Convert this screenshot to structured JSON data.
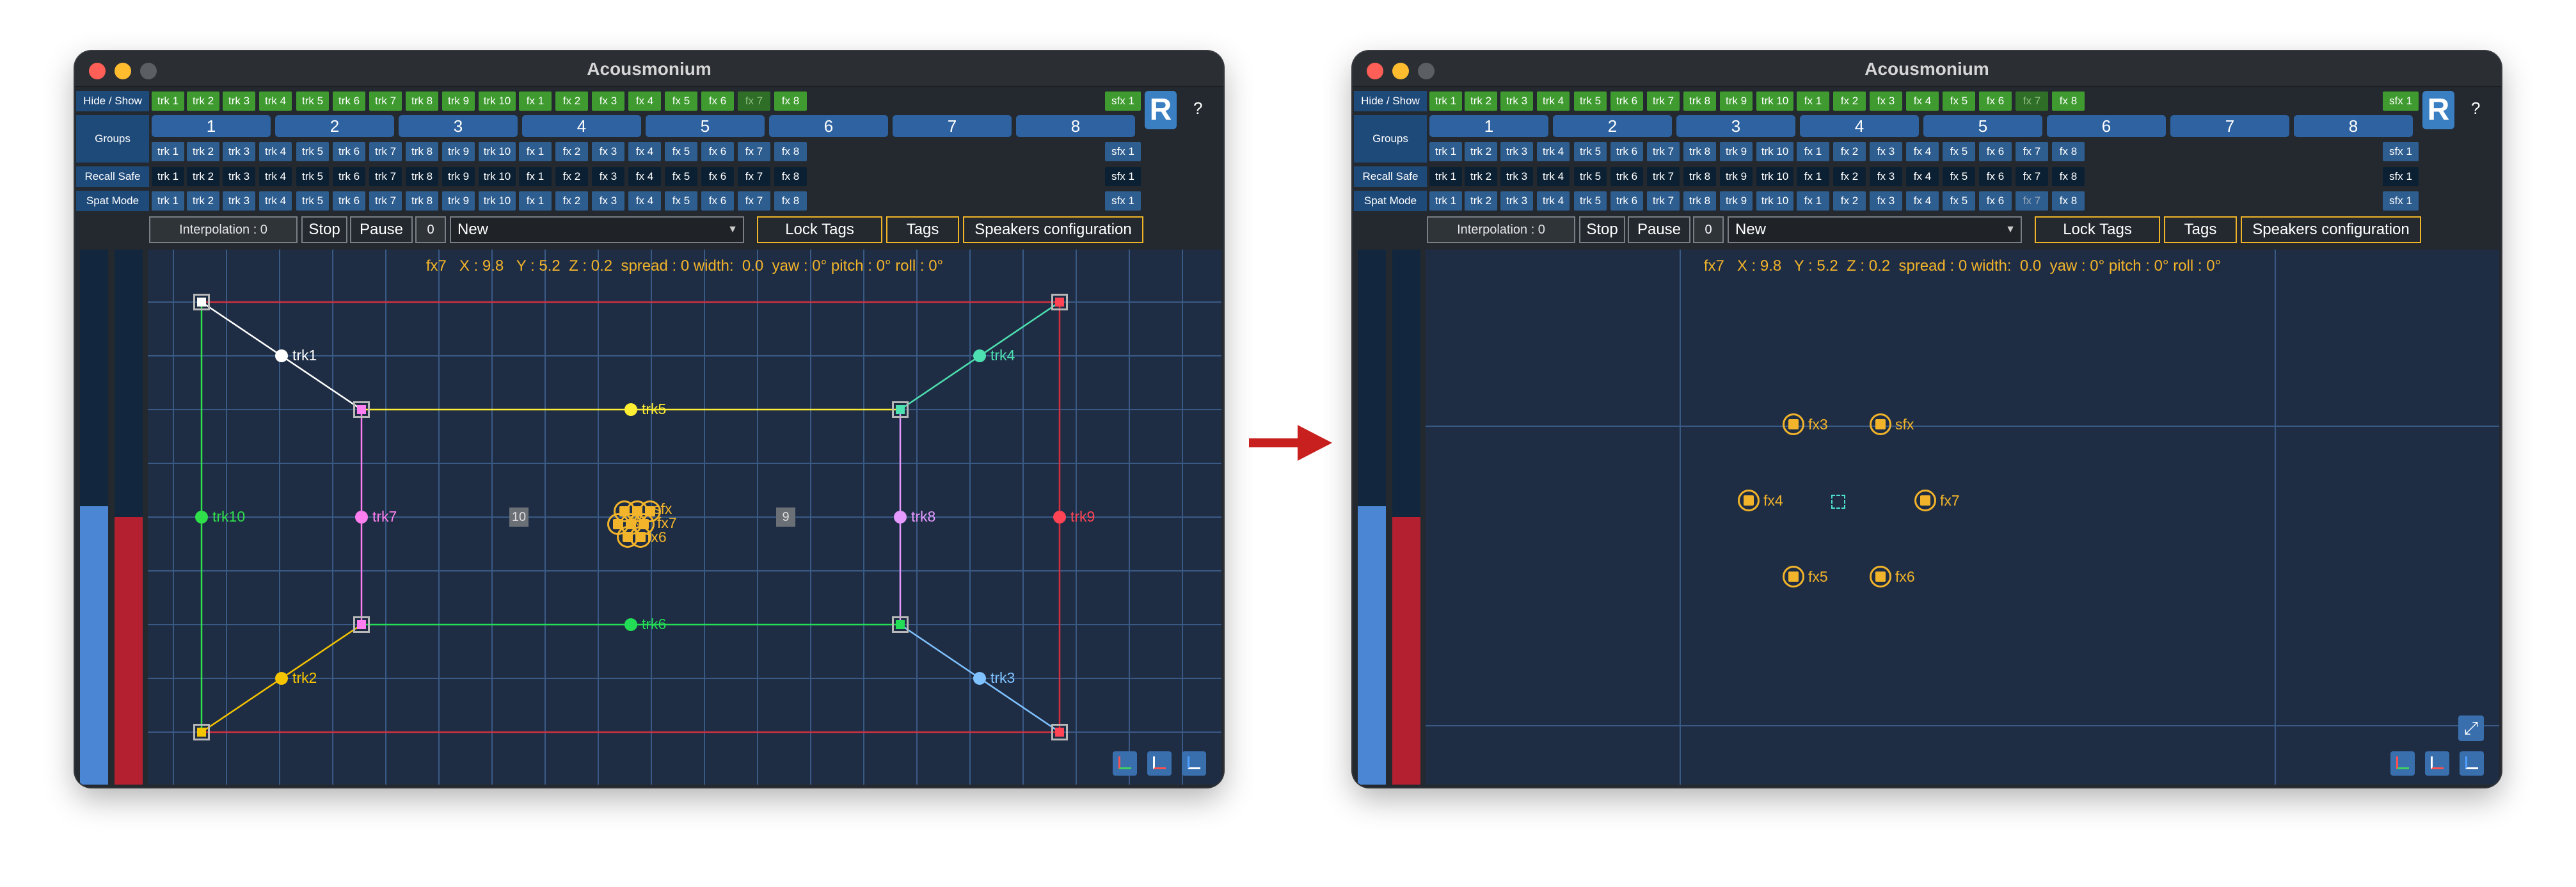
{
  "window": {
    "title": "Acousmonium"
  },
  "rows": {
    "hide_show": "Hide / Show",
    "groups": "Groups",
    "recall_safe": "Recall Safe",
    "spat_mode": "Spat Mode"
  },
  "tracks": [
    "trk 1",
    "trk 2",
    "trk 3",
    "trk 4",
    "trk 5",
    "trk 6",
    "trk 7",
    "trk 8",
    "trk 9",
    "trk 10"
  ],
  "fx": [
    "fx 1",
    "fx 2",
    "fx 3",
    "fx 4",
    "fx 5",
    "fx 6",
    "fx 7",
    "fx 8"
  ],
  "sfx": "sfx 1",
  "group_numbers": [
    "1",
    "2",
    "3",
    "4",
    "5",
    "6",
    "7",
    "8"
  ],
  "r_button": "R",
  "help_button": "?",
  "controls": {
    "interpolation": "Interpolation : 0",
    "stop": "Stop",
    "pause": "Pause",
    "pause_value": "0",
    "preset_selected": "New",
    "lock_tags": "Lock Tags",
    "tags": "Tags",
    "speakers_configuration": "Speakers configuration"
  },
  "info_line": "fx7   X : 9.8   Y : 5.2  Z : 0.2  spread : 0 width:  0.0  yaw : 0° pitch : 0° roll : 0°",
  "meters": {
    "left_level": 0.52,
    "right_level": 0.5
  },
  "speakers": {
    "trk1": "trk1",
    "trk2": "trk2",
    "trk3": "trk3",
    "trk4": "trk4",
    "trk5": "trk5",
    "trk6": "trk6",
    "trk7": "trk7",
    "trk8": "trk8",
    "trk9": "trk9",
    "trk10": "trk10",
    "box_10": "10",
    "box_9": "9"
  },
  "cluster_labels": [
    "sfx",
    "fx7",
    "fx6",
    "fx5"
  ],
  "zoom_sources": {
    "fx3": "fx3",
    "sfx": "sfx",
    "fx4": "fx4",
    "fx7": "fx7",
    "fx5": "fx5",
    "fx6": "fx6"
  },
  "colors": {
    "trk1": "#ffffff",
    "trk2": "#f5c400",
    "trk3": "#7fc2ff",
    "trk4": "#4de0b0",
    "trk5": "#ffee33",
    "trk6": "#22dd55",
    "trk7": "#ff7ff0",
    "trk8": "#e59aff",
    "trk9": "#ff4455",
    "trk10": "#2fe04a",
    "fx": "#f2b42a"
  }
}
